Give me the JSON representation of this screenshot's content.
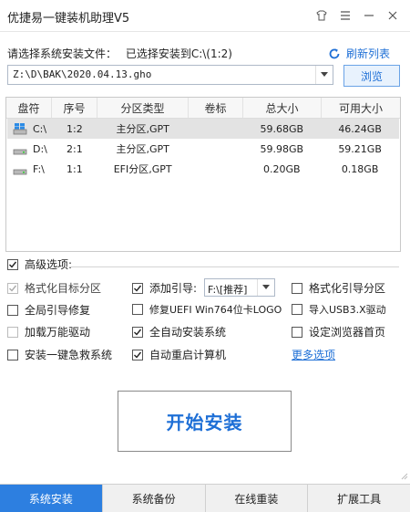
{
  "window": {
    "title": "优捷易一键装机助理V5"
  },
  "source": {
    "prompt_label": "请选择系统安装文件：",
    "selected_label": "已选择安装到C:\\(1:2)",
    "refresh_label": "刷新列表",
    "path_value": "Z:\\D\\BAK\\2020.04.13.gho",
    "browse_label": "浏览"
  },
  "table": {
    "headers": [
      "盘符",
      "序号",
      "分区类型",
      "卷标",
      "总大小",
      "可用大小"
    ],
    "rows": [
      {
        "drive": "C:\\",
        "index": "1:2",
        "type": "主分区,GPT",
        "label": "",
        "total": "59.68GB",
        "free": "46.24GB"
      },
      {
        "drive": "D:\\",
        "index": "2:1",
        "type": "主分区,GPT",
        "label": "",
        "total": "59.98GB",
        "free": "59.21GB"
      },
      {
        "drive": "F:\\",
        "index": "1:1",
        "type": "EFI分区,GPT",
        "label": "",
        "total": "0.20GB",
        "free": "0.18GB"
      }
    ]
  },
  "advanced": {
    "label": "高级选项:",
    "format_target": "格式化目标分区",
    "add_boot": "添加引导:",
    "boot_select": "F:\\[推荐]",
    "format_boot": "格式化引导分区",
    "global_boot_fix": "全局引导修复",
    "fix_uefi": "修复UEFI Win764位卡LOGO",
    "import_usb3": "导入USB3.X驱动",
    "load_drivers": "加载万能驱动",
    "auto_install": "全自动安装系统",
    "set_homepage": "设定浏览器首页",
    "install_rescue": "安装一键急救系统",
    "auto_restart": "自动重启计算机",
    "more_options": "更多选项"
  },
  "start_button": "开始安装",
  "tabs": [
    "系统安装",
    "系统备份",
    "在线重装",
    "扩展工具"
  ],
  "colors": {
    "accent": "#1e6fd6",
    "tab_active": "#2d7fe0"
  }
}
